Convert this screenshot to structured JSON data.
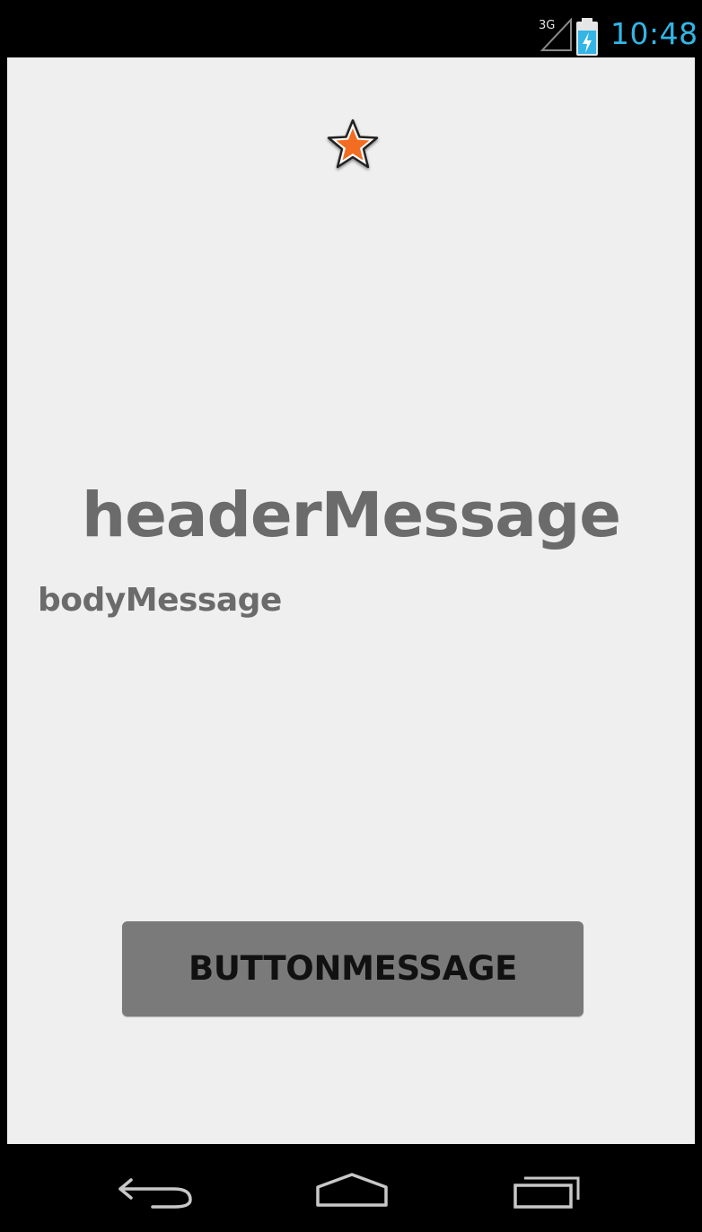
{
  "status_bar": {
    "network_label": "3G",
    "time": "10:48",
    "time_color": "#33b5e5",
    "icons": [
      "signal-3g-icon",
      "battery-charging-icon"
    ]
  },
  "content": {
    "star_icon": "star-icon",
    "star_color": "#f26d21",
    "header_message": "headerMessage",
    "body_message": "bodyMessage",
    "button_label": "BUTTONMESSAGE",
    "text_color": "#6b6b6b",
    "button_color": "#7a7a7a",
    "background_color": "#efefef"
  },
  "nav_bar": {
    "buttons": [
      {
        "name": "back",
        "icon": "back-icon"
      },
      {
        "name": "home",
        "icon": "home-icon"
      },
      {
        "name": "recents",
        "icon": "recent-apps-icon"
      }
    ]
  }
}
